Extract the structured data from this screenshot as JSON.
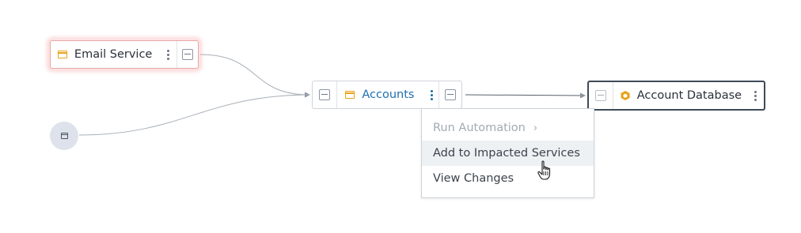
{
  "nodes": {
    "email": {
      "label": "Email Service",
      "icon": "application-icon"
    },
    "accounts": {
      "label": "Accounts",
      "icon": "application-icon"
    },
    "database": {
      "label": "Account Database",
      "icon": "database-hexagon-icon"
    },
    "unnamed": {
      "icon": "application-icon"
    }
  },
  "context_menu": {
    "items": [
      {
        "label": "Run Automation",
        "state": "disabled",
        "has_submenu": true
      },
      {
        "label": "Add to Impacted Services",
        "state": "hover"
      },
      {
        "label": "View Changes",
        "state": "normal"
      }
    ]
  },
  "colors": {
    "accent_link": "#1e6fb0",
    "icon_app": "#e8a218",
    "highlight_glow": "#f4a0a0",
    "selected_border": "#3e4a57"
  }
}
